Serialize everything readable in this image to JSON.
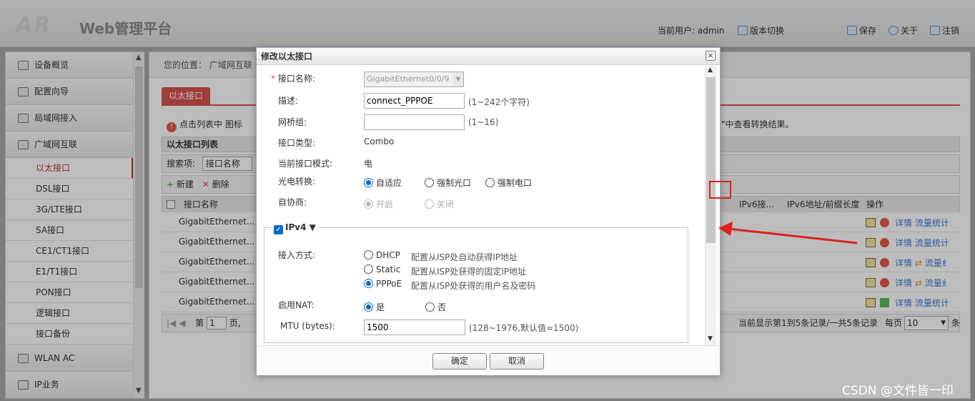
{
  "header": {
    "logo": "AR",
    "brand": "Web管理平台",
    "current_user": "当前用户: admin",
    "version_switch": "版本切换",
    "save": "保存",
    "about": "关于",
    "logout": "注销"
  },
  "sidebar": {
    "items": [
      {
        "label": "设备概览"
      },
      {
        "label": "配置向导"
      },
      {
        "label": "局域网接入"
      },
      {
        "label": "广域网互联"
      }
    ],
    "sub_items": [
      {
        "label": "以太接口"
      },
      {
        "label": "DSL接口"
      },
      {
        "label": "3G/LTE接口"
      },
      {
        "label": "SA接口"
      },
      {
        "label": "CE1/CT1接口"
      },
      {
        "label": "E1/T1接口"
      },
      {
        "label": "PON接口"
      },
      {
        "label": "逻辑接口"
      },
      {
        "label": "接口备份"
      }
    ],
    "bottom_items": [
      {
        "label": "WLAN AC"
      },
      {
        "label": "IP业务"
      }
    ]
  },
  "main": {
    "breadcrumb": "您的位置： 广域网互联",
    "tab": "以太接口",
    "tip_left": "点击列表中",
    "tip_icon": "图标",
    "tip_right": "口\"中查看转换结果。",
    "list_title": "以太接口列表",
    "search_label": "搜索项:",
    "search_value": "接口名称",
    "new_btn": "新建",
    "delete_btn": "删除",
    "columns": {
      "name": "接口名称",
      "ipv6": "IPv6接...",
      "ipv6_prefix": "IPv6地址/前缀长度",
      "ops": "操作"
    },
    "rows": [
      {
        "name": "GigabitEthernet...",
        "detail": "详情",
        "swap": "",
        "stats": "流量统计"
      },
      {
        "name": "GigabitEthernet...",
        "detail": "详情",
        "swap": "",
        "stats": "流量统计"
      },
      {
        "name": "GigabitEthernet...",
        "detail": "详情",
        "swap": "⇄",
        "stats": "流量纟"
      },
      {
        "name": "GigabitEthernet...",
        "detail": "详情",
        "swap": "⇄",
        "stats": "流量纟"
      },
      {
        "name": "GigabitEthernet...",
        "detail": "详情",
        "swap": "",
        "stats": "流量统计"
      }
    ],
    "pager": {
      "page_prefix": "第",
      "page_value": "1",
      "page_suffix": "页,",
      "summary": "当前显示第1到5条记录/一共5条记录",
      "per_page": "每页",
      "per_page_value": "10",
      "per_page_suffix": "条"
    }
  },
  "dialog": {
    "title": "修改以太接口",
    "close": "×",
    "name_label": "接口名称:",
    "name_value": "GigabitEthernet0/0/9",
    "desc_label": "描述:",
    "desc_value": "connect_PPPOE",
    "desc_hint": "(1~242个字符)",
    "bridge_label": "网桥组:",
    "bridge_value": "",
    "bridge_hint": "(1~16)",
    "type_label": "接口类型:",
    "type_value": "Combo",
    "mode_label": "当前接口模式:",
    "mode_value": "电",
    "optic_label": "光电转换:",
    "optic_options": [
      "自适应",
      "强制光口",
      "强制电口"
    ],
    "auto_label": "自协商:",
    "auto_options": [
      "开启",
      "关闭"
    ],
    "ipv4_label": "IPv4",
    "access_label": "接入方式:",
    "access_options": [
      {
        "label": "DHCP",
        "desc": "配置从ISP处自动获得IP地址"
      },
      {
        "label": "Static",
        "desc": "配置从ISP处获得的固定IP地址"
      },
      {
        "label": "PPPoE",
        "desc": "配置从ISP处获得的用户名及密码"
      }
    ],
    "nat_label": "启用NAT:",
    "nat_yes": "是",
    "nat_no": "否",
    "mtu_label": "MTU (bytes):",
    "mtu_value": "1500",
    "mtu_hint": "(128~1976,默认值=1500)",
    "ok": "确定",
    "cancel": "取消"
  },
  "watermark": "CSDN @文件皆一印",
  "colors": {
    "accent": "#d9534f",
    "link": "#3b7dd8",
    "radio": "#0b6bc7",
    "annotation": "#e02020"
  }
}
